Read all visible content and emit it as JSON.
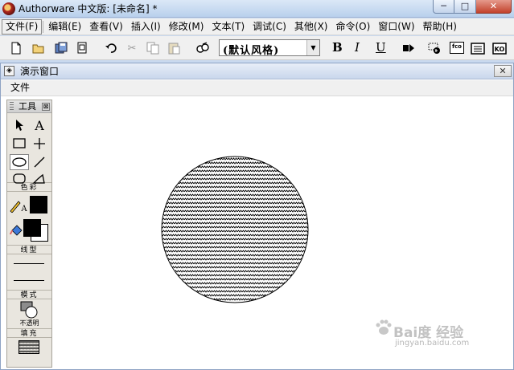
{
  "window": {
    "title": "Authorware 中文版: [未命名] *",
    "minimize": "─",
    "maximize": "□",
    "close": "✕"
  },
  "menubar": [
    "文件(F)",
    "编辑(E)",
    "查看(V)",
    "插入(I)",
    "修改(M)",
    "文本(T)",
    "调试(C)",
    "其他(X)",
    "命令(O)",
    "窗口(W)",
    "帮助(H)"
  ],
  "toolbar": {
    "style_value": "(默认风格)",
    "bold": "B",
    "italic": "I",
    "underline": "U",
    "fx_label": "fco"
  },
  "presentation": {
    "title": "演示窗口",
    "close": "✕",
    "menu_file": "文件"
  },
  "palette": {
    "title": "工具",
    "close": "⊠",
    "section_color": "色彩",
    "section_line": "线型",
    "section_mode": "模式",
    "mode_caption": "不透明",
    "section_fill": "填充"
  },
  "watermark": {
    "main": "Bai度 经验",
    "sub": "jingyan.baidu.com"
  },
  "colors": {
    "accent": "#b9d0ec",
    "canvas": "#ffffff",
    "shape_stroke": "#000000"
  }
}
